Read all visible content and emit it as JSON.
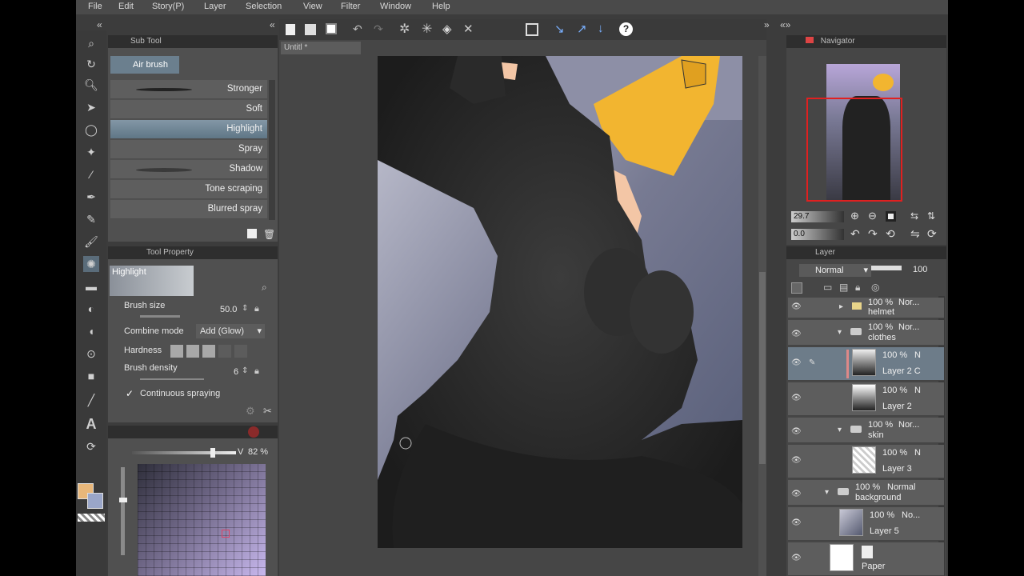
{
  "menu": [
    "File",
    "Edit",
    "Story(P)",
    "Layer",
    "Selection",
    "View",
    "Filter",
    "Window",
    "Help"
  ],
  "subtool": {
    "header": "Sub Tool",
    "group": "Air brush",
    "brushes": [
      "Stronger",
      "Soft",
      "Highlight",
      "Spray",
      "Shadow",
      "Tone scraping",
      "Blurred spray"
    ],
    "selected_index": 2
  },
  "tool_property": {
    "header": "Tool Property",
    "preview_label": "Highlight",
    "brush_size_label": "Brush size",
    "brush_size_value": "50.0",
    "combine_mode_label": "Combine mode",
    "combine_mode_value": "Add (Glow)",
    "hardness_label": "Hardness",
    "density_label": "Brush density",
    "density_value": "6",
    "continuous_label": "Continuous spraying",
    "continuous_checked": true
  },
  "color": {
    "value_label": "V",
    "value": "82 %",
    "main_color": "#e8b77a",
    "sub_color": "#9aa6c8"
  },
  "canvas_tab": "Untitl *",
  "navigator": {
    "tab": "Navigator",
    "zoom": "29.7",
    "rotate": "0.0"
  },
  "layer_panel": {
    "tab": "Layer",
    "blend_mode": "Normal",
    "opacity": "100",
    "layers": [
      {
        "pct": "100 %",
        "mode": "Nor...",
        "name": "helmet",
        "type": "folder"
      },
      {
        "pct": "100 %",
        "mode": "Nor...",
        "name": "clothes",
        "type": "folder"
      },
      {
        "pct": "100 %",
        "mode": "N",
        "name": "Layer 2 C",
        "type": "layer",
        "selected": true
      },
      {
        "pct": "100 %",
        "mode": "N",
        "name": "Layer 2",
        "type": "layer"
      },
      {
        "pct": "100 %",
        "mode": "Nor...",
        "name": "skin",
        "type": "folder"
      },
      {
        "pct": "100 %",
        "mode": "N",
        "name": "Layer 3",
        "type": "layer"
      },
      {
        "pct": "100 %",
        "mode": "Normal",
        "name": "background",
        "type": "folder"
      },
      {
        "pct": "100 %",
        "mode": "No...",
        "name": "Layer 5",
        "type": "layer"
      },
      {
        "pct": "",
        "mode": "",
        "name": "Paper",
        "type": "paper"
      }
    ]
  },
  "colors": {
    "accent_selection": "#6f8596",
    "panel_bg": "#464646",
    "hair_yellow": "#f2b530",
    "skin": "#f3c6a6",
    "suit": "#2a2a2a"
  }
}
